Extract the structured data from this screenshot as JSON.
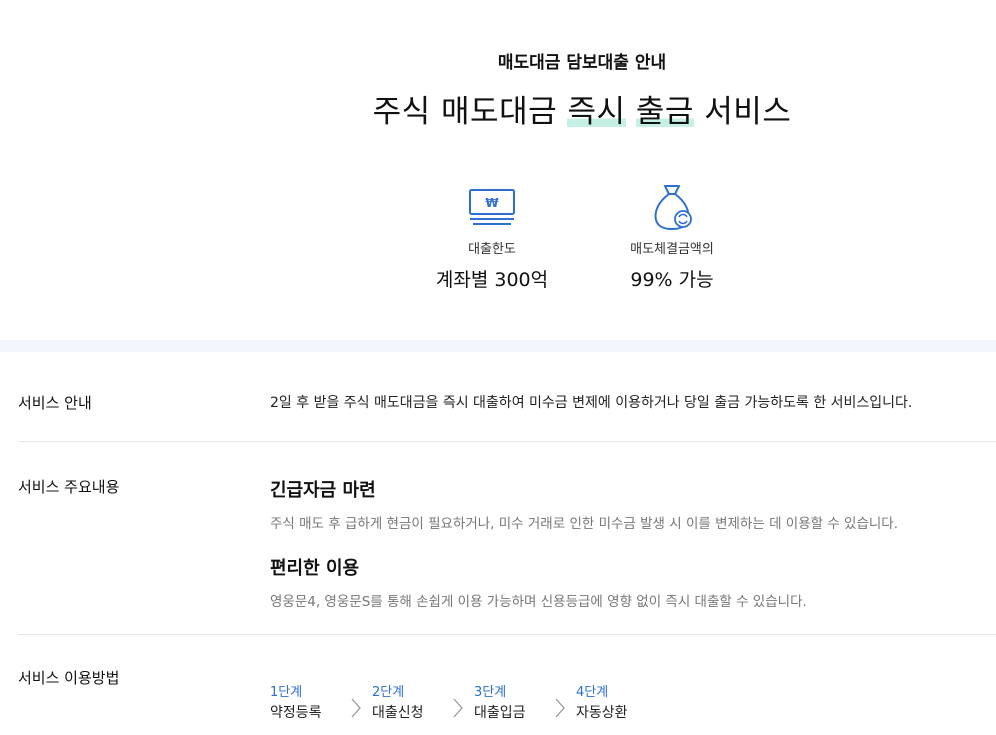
{
  "hero": {
    "eyebrow": "매도대금 담보대출 안내",
    "headline_pre": "주식 매도대금 ",
    "headline_hl1": "즉시",
    "headline_sp": " ",
    "headline_hl2": "출금",
    "headline_post": " 서비스"
  },
  "stats": [
    {
      "icon": "won-monitor-icon",
      "label": "대출한도",
      "value": "계좌별 300억"
    },
    {
      "icon": "money-bag-icon",
      "label": "매도체결금액의",
      "value": "99% 가능"
    }
  ],
  "colors": {
    "accent_blue": "#2d6fd2",
    "highlight_mint": "#c6f0e6",
    "band": "#f2f6fc"
  },
  "sections": {
    "guide": {
      "title": "서비스 안내",
      "text": "2일 후 받을 주식 매도대금을 즉시 대출하여 미수금 변제에 이용하거나 당일 출금 가능하도록 한 서비스입니다."
    },
    "features": {
      "title": "서비스 주요내용",
      "items": [
        {
          "title": "긴급자금 마련",
          "desc": "주식 매도 후 급하게 현금이 필요하거나, 미수 거래로 인한 미수금 발생 시 이를 변제하는 데 이용할 수 있습니다."
        },
        {
          "title": "편리한 이용",
          "desc": "영웅문4, 영웅문S를 통해 손쉽게 이용 가능하며 신용등급에 영향 없이 즉시 대출할 수 있습니다."
        }
      ]
    },
    "howto": {
      "title": "서비스 이용방법",
      "steps": [
        {
          "num": "1단계",
          "name": "약정등록"
        },
        {
          "num": "2단계",
          "name": "대출신청"
        },
        {
          "num": "3단계",
          "name": "대출입금"
        },
        {
          "num": "4단계",
          "name": "자동상환"
        }
      ]
    }
  }
}
